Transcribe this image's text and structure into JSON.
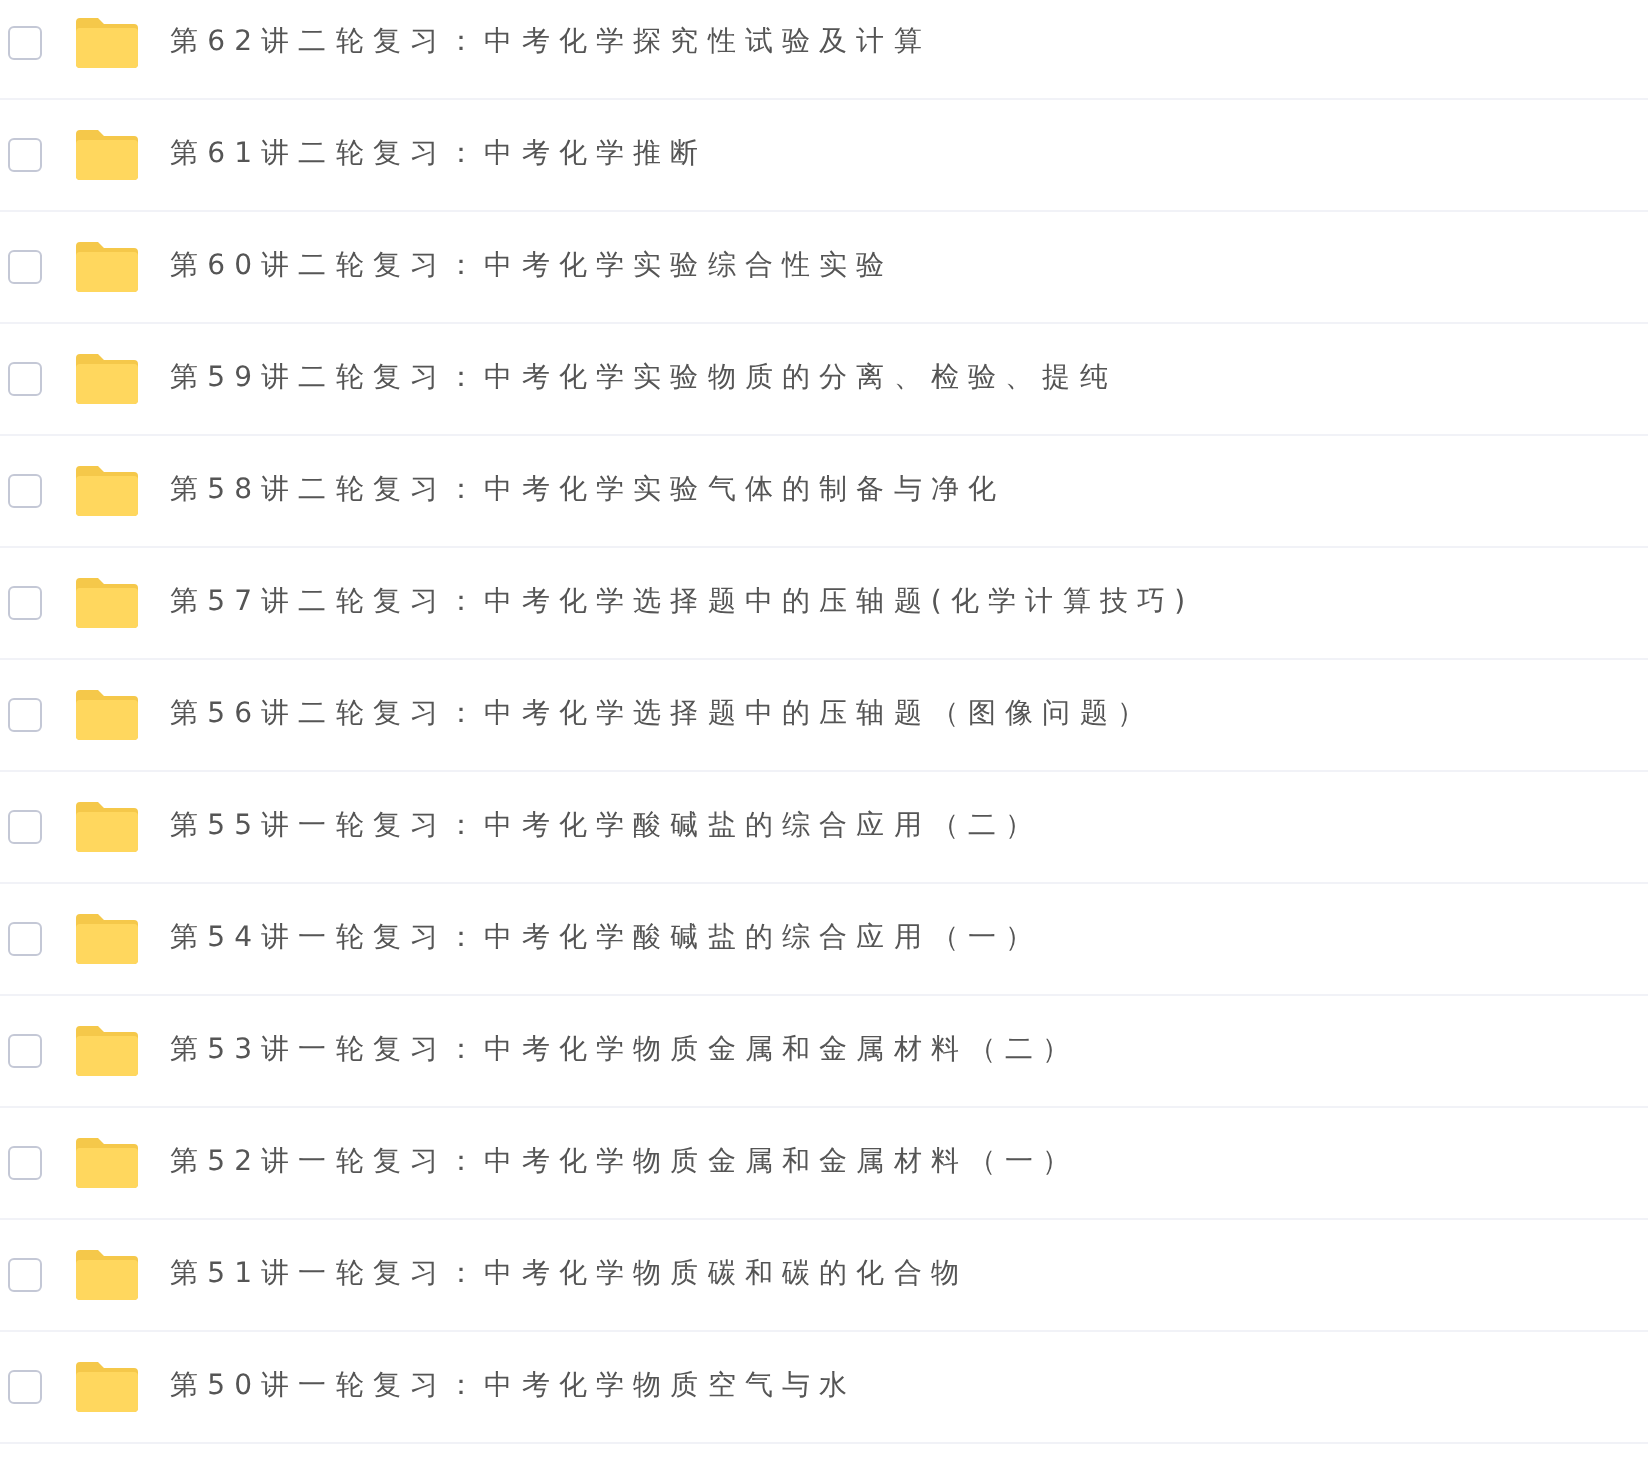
{
  "files": [
    {
      "name": "第62讲二轮复习：中考化学探究性试验及计算",
      "checked": false
    },
    {
      "name": "第61讲二轮复习：中考化学推断",
      "checked": false
    },
    {
      "name": "第60讲二轮复习：中考化学实验综合性实验",
      "checked": false
    },
    {
      "name": "第59讲二轮复习：中考化学实验物质的分离、检验、提纯",
      "checked": false
    },
    {
      "name": "第58讲二轮复习：中考化学实验气体的制备与净化",
      "checked": false
    },
    {
      "name": "第57讲二轮复习：中考化学选择题中的压轴题(化学计算技巧)",
      "checked": false
    },
    {
      "name": "第56讲二轮复习：中考化学选择题中的压轴题（图像问题）",
      "checked": false
    },
    {
      "name": "第55讲一轮复习：中考化学酸碱盐的综合应用（二）",
      "checked": false
    },
    {
      "name": "第54讲一轮复习：中考化学酸碱盐的综合应用（一）",
      "checked": false
    },
    {
      "name": "第53讲一轮复习：中考化学物质金属和金属材料（二）",
      "checked": false
    },
    {
      "name": "第52讲一轮复习：中考化学物质金属和金属材料（一）",
      "checked": false
    },
    {
      "name": "第51讲一轮复习：中考化学物质碳和碳的化合物",
      "checked": false
    },
    {
      "name": "第50讲一轮复习：中考化学物质空气与水",
      "checked": false
    }
  ]
}
